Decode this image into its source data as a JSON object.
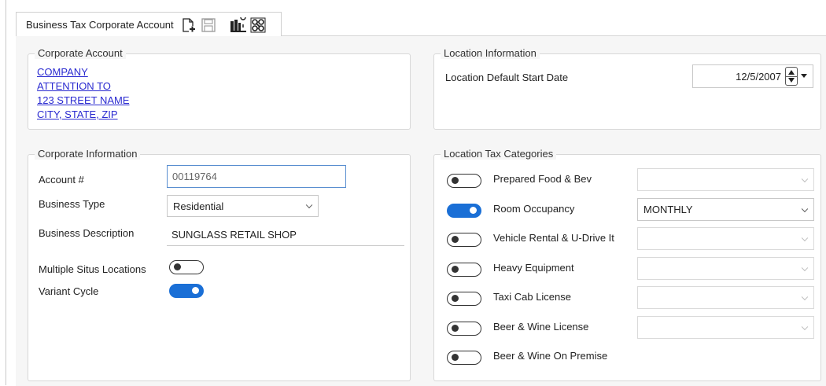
{
  "tab": {
    "title": "Business Tax Corporate Account",
    "icons": [
      "new-document-icon",
      "save-icon",
      "map-pin-icon",
      "network-icon"
    ]
  },
  "corporate_account": {
    "legend": "Corporate Account",
    "lines": [
      "COMPANY",
      "ATTENTION TO",
      "123 STREET NAME",
      "CITY, STATE, ZIP"
    ]
  },
  "location_information": {
    "legend": "Location Information",
    "default_start_date_label": "Location Default Start Date",
    "default_start_date": "12/5/2007"
  },
  "corporate_information": {
    "legend": "Corporate Information",
    "account_label": "Account #",
    "account_value": "00119764",
    "business_type_label": "Business Type",
    "business_type_value": "Residential",
    "business_description_label": "Business Description",
    "business_description_value": "SUNGLASS RETAIL SHOP",
    "multiple_situs_label": "Multiple Situs Locations",
    "multiple_situs_on": false,
    "variant_cycle_label": "Variant Cycle",
    "variant_cycle_on": true
  },
  "location_tax_categories": {
    "legend": "Location Tax Categories",
    "items": [
      {
        "label": "Prepared Food & Bev",
        "on": false,
        "select": ""
      },
      {
        "label": "Room Occupancy",
        "on": true,
        "select": "MONTHLY"
      },
      {
        "label": "Vehicle Rental & U-Drive It",
        "on": false,
        "select": ""
      },
      {
        "label": "Heavy Equipment",
        "on": false,
        "select": ""
      },
      {
        "label": "Taxi Cab License",
        "on": false,
        "select": ""
      },
      {
        "label": "Beer & Wine License",
        "on": false,
        "select": ""
      },
      {
        "label": "Beer & Wine On Premise",
        "on": false
      }
    ]
  },
  "colors": {
    "toggle_on": "#1a6fd6",
    "link": "#2a2ad0",
    "focus_border": "#5a8fd0"
  }
}
